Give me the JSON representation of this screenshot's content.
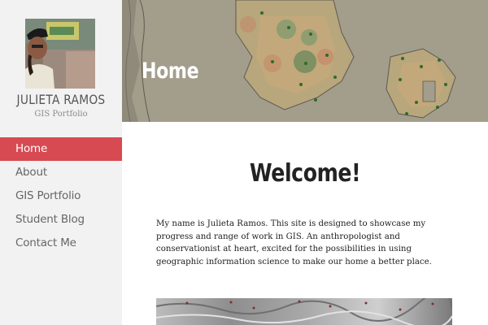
{
  "site": {
    "name": "JULIETA RAMOS",
    "tagline": "GIS Portfolio"
  },
  "nav": {
    "items": [
      {
        "label": "Home",
        "active": true
      },
      {
        "label": "About",
        "active": false
      },
      {
        "label": "GIS Portfolio",
        "active": false
      },
      {
        "label": "Student Blog",
        "active": false
      },
      {
        "label": "Contact Me",
        "active": false
      }
    ]
  },
  "banner": {
    "title": "Home"
  },
  "main": {
    "heading": "Welcome!",
    "intro": "My name is Julieta Ramos. This site is designed to showcase my progress and range of work in GIS. An anthropologist and conservationist at heart, excited for the possibilities in using geographic information science to make our home a better place."
  },
  "colors": {
    "accent": "#d74a52",
    "sidebar_bg": "#f2f2f2",
    "banner_overlay": "#9e9886"
  }
}
